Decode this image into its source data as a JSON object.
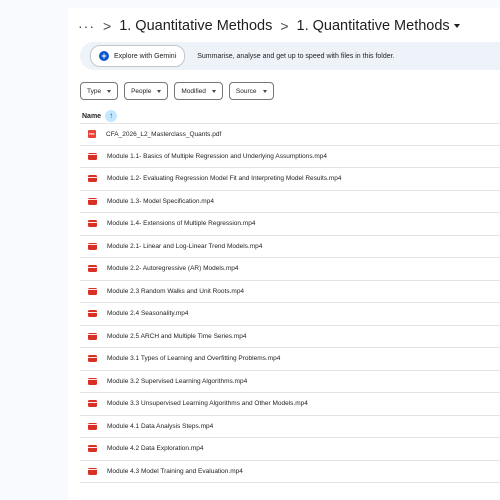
{
  "breadcrumb": {
    "more": "···",
    "separator": ">",
    "items": [
      "1. Quantitative Methods",
      "1. Quantitative Methods"
    ]
  },
  "gemini": {
    "button_label": "Explore with Gemini",
    "prompt_text": "Summarise, analyse and get up to speed with files in this folder."
  },
  "filters": [
    "Type",
    "People",
    "Modified",
    "Source"
  ],
  "list_header": {
    "name_label": "Name",
    "sort_icon": "↑"
  },
  "files": [
    {
      "name": "CFA_2026_L2_Masterclass_Quants.pdf",
      "type": "pdf"
    },
    {
      "name": "Module 1.1- Basics of Multiple Regression and Underlying Assumptions.mp4",
      "type": "video"
    },
    {
      "name": "Module 1.2- Evaluating Regression Model Fit and Interpreting Model Results.mp4",
      "type": "video"
    },
    {
      "name": "Module 1.3- Model Specification.mp4",
      "type": "video"
    },
    {
      "name": "Module 1.4- Extensions of Multiple Regression.mp4",
      "type": "video"
    },
    {
      "name": "Module 2.1- Linear and Log-Linear Trend Models.mp4",
      "type": "video"
    },
    {
      "name": "Module 2.2- Autoregressive (AR) Models.mp4",
      "type": "video"
    },
    {
      "name": "Module 2.3 Random Walks and Unit Roots.mp4",
      "type": "video"
    },
    {
      "name": "Module 2.4 Seasonality.mp4",
      "type": "video"
    },
    {
      "name": "Module 2.5 ARCH and Multiple Time Series.mp4",
      "type": "video"
    },
    {
      "name": "Module 3.1 Types of Learning and Overfitting Problems.mp4",
      "type": "video"
    },
    {
      "name": "Module 3.2 Supervised Learning Algorithms.mp4",
      "type": "video"
    },
    {
      "name": "Module 3.3 Unsupervised Learning Algorithms and Other Models.mp4",
      "type": "video"
    },
    {
      "name": "Module 4.1 Data Analysis Steps.mp4",
      "type": "video"
    },
    {
      "name": "Module 4.2 Data Exploration.mp4",
      "type": "video"
    },
    {
      "name": "Module 4.3 Model Training and Evaluation.mp4",
      "type": "video"
    }
  ],
  "colors": {
    "accent": "#0b57d0",
    "file_icon": "#d93025",
    "gemini_bar": "#eef2f9"
  }
}
